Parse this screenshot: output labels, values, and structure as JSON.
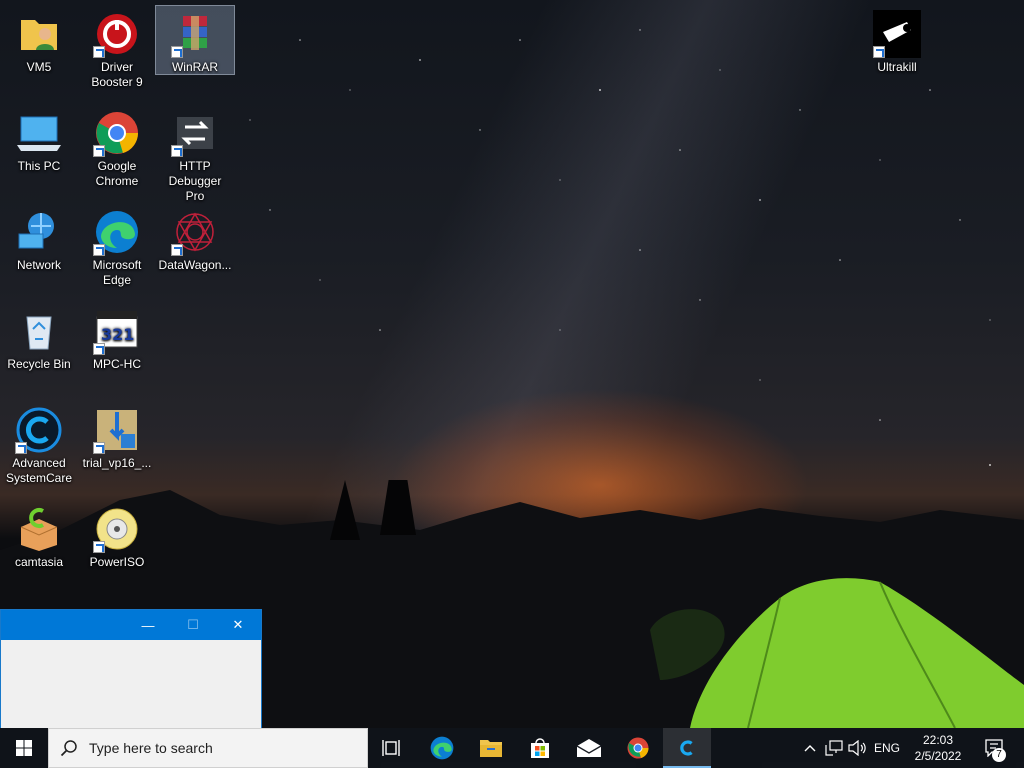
{
  "desktop": {
    "icons": [
      {
        "label": "VM5",
        "icon": "folder-user-icon"
      },
      {
        "label": "Driver Booster 9",
        "icon": "driver-booster-icon"
      },
      {
        "label": "WinRAR",
        "icon": "winrar-icon",
        "selected": true
      },
      {
        "label": "Ultrakill",
        "icon": "ultrakill-icon"
      },
      {
        "label": "This PC",
        "icon": "this-pc-icon"
      },
      {
        "label": "Google Chrome",
        "icon": "chrome-icon"
      },
      {
        "label": "HTTP Debugger Pro",
        "icon": "http-debugger-icon"
      },
      {
        "label": "Network",
        "icon": "network-icon"
      },
      {
        "label": "Microsoft Edge",
        "icon": "edge-icon"
      },
      {
        "label": "DataWagon...",
        "icon": "datawagon-icon"
      },
      {
        "label": "Recycle Bin",
        "icon": "recycle-bin-icon"
      },
      {
        "label": "MPC-HC",
        "icon": "mpc-hc-icon"
      },
      {
        "label": "Advanced SystemCare",
        "icon": "advanced-systemcare-icon"
      },
      {
        "label": "trial_vp16_...",
        "icon": "installer-icon"
      },
      {
        "label": "camtasia",
        "icon": "camtasia-icon"
      },
      {
        "label": "PowerISO",
        "icon": "poweriso-icon"
      }
    ]
  },
  "window": {
    "minimize_glyph": "—",
    "maximize_glyph": "☐",
    "close_glyph": "✕"
  },
  "taskbar": {
    "search_placeholder": "Type here to search",
    "apps": [
      "task-view-icon",
      "edge-icon",
      "file-explorer-icon",
      "microsoft-store-icon",
      "mail-icon",
      "chrome-icon",
      "advanced-systemcare-icon"
    ],
    "active_app": "advanced-systemcare-icon",
    "tray": {
      "chevron": "^",
      "language": "ENG",
      "time": "22:03",
      "date": "2/5/2022",
      "notification_count": "7"
    }
  },
  "colors": {
    "accent": "#0078d7",
    "taskbar": "#10141a",
    "tent": "#8fd63a"
  }
}
